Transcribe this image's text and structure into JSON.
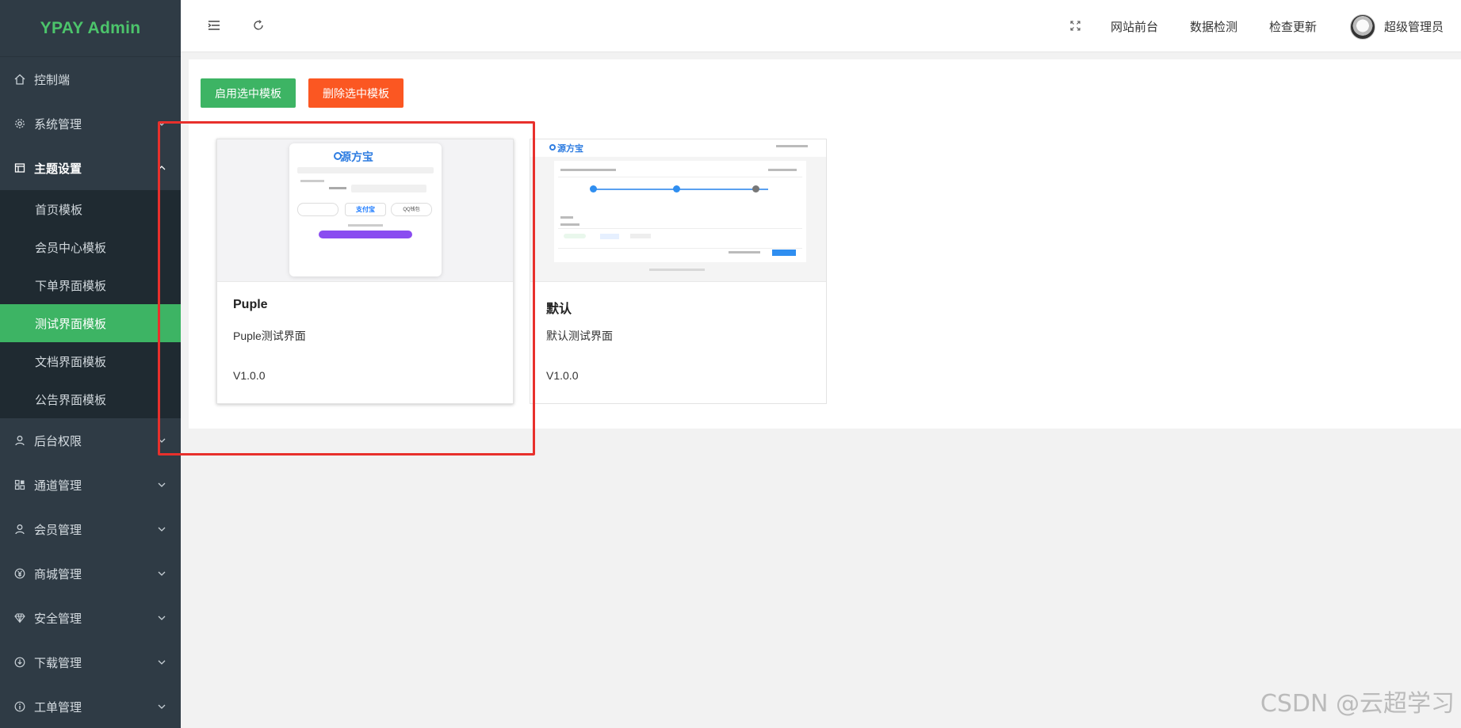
{
  "brand": "YPAY Admin",
  "sidebar": {
    "items": [
      {
        "label": "控制端",
        "icon": "home-icon",
        "has_chevron": false
      },
      {
        "label": "系统管理",
        "icon": "gear-icon",
        "has_chevron": true
      },
      {
        "label": "主题设置",
        "icon": "layout-icon",
        "has_chevron": true,
        "open": true
      }
    ],
    "submenu": [
      {
        "label": "首页模板",
        "active": false
      },
      {
        "label": "会员中心模板",
        "active": false
      },
      {
        "label": "下单界面模板",
        "active": false
      },
      {
        "label": "测试界面模板",
        "active": true
      },
      {
        "label": "文档界面模板",
        "active": false
      },
      {
        "label": "公告界面模板",
        "active": false
      }
    ],
    "items_after": [
      {
        "label": "后台权限",
        "icon": "user-icon"
      },
      {
        "label": "通道管理",
        "icon": "apps-icon"
      },
      {
        "label": "会员管理",
        "icon": "user-icon"
      },
      {
        "label": "商城管理",
        "icon": "yen-icon"
      },
      {
        "label": "安全管理",
        "icon": "diamond-icon"
      },
      {
        "label": "下载管理",
        "icon": "download-icon"
      },
      {
        "label": "工单管理",
        "icon": "info-icon"
      }
    ]
  },
  "topbar": {
    "links": [
      "网站前台",
      "数据检测",
      "检查更新"
    ],
    "user": "超级管理员"
  },
  "toolbar": {
    "enable_label": "启用选中模板",
    "delete_label": "删除选中模板"
  },
  "templates": [
    {
      "title": "Puple",
      "desc": "Puple测试界面",
      "version": "V1.0.0"
    },
    {
      "title": "默认",
      "desc": "默认测试界面",
      "version": "V1.0.0"
    }
  ],
  "thumb_text": {
    "puple_logo": "源方宝",
    "default_logo": "源方宝",
    "alipay": "支付宝",
    "qq": "QQ钱包"
  },
  "watermark": "CSDN @云超学习",
  "colors": {
    "sidebar_bg": "#2f3b45",
    "submenu_bg": "#1f2a31",
    "brand_green": "#4cc46b",
    "active_green": "#3db464",
    "orange": "#fb5722",
    "highlight_red": "#e8302c",
    "purple": "#8a4cf0"
  }
}
